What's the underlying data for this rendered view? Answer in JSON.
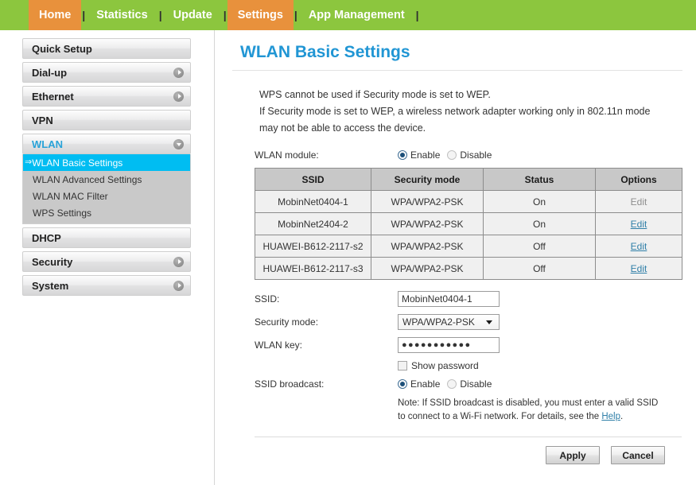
{
  "topnav": {
    "items": [
      {
        "label": "Home",
        "active": true
      },
      {
        "label": "Statistics",
        "active": false
      },
      {
        "label": "Update",
        "active": false
      },
      {
        "label": "Settings",
        "active": true
      },
      {
        "label": "App Management",
        "active": false
      }
    ],
    "separator": "|"
  },
  "sidebar": {
    "groups": [
      {
        "label": "Quick Setup",
        "icon": "none"
      },
      {
        "label": "Dial-up",
        "icon": "chevron-right-icon"
      },
      {
        "label": "Ethernet",
        "icon": "chevron-right-icon"
      },
      {
        "label": "VPN",
        "icon": "none"
      },
      {
        "label": "WLAN",
        "icon": "chevron-down-icon"
      },
      {
        "label": "DHCP",
        "icon": "none"
      },
      {
        "label": "Security",
        "icon": "chevron-right-icon"
      },
      {
        "label": "System",
        "icon": "chevron-right-icon"
      }
    ],
    "wlan_submenu": [
      {
        "label": "WLAN Basic Settings",
        "active": true
      },
      {
        "label": "WLAN Advanced Settings",
        "active": false
      },
      {
        "label": "WLAN MAC Filter",
        "active": false
      },
      {
        "label": "WPS Settings",
        "active": false
      }
    ],
    "active_marker": "⇒"
  },
  "main": {
    "title": "WLAN Basic Settings",
    "intro_lines": [
      "WPS cannot be used if Security mode is set to WEP.",
      "If Security mode is set to WEP, a wireless network adapter working only in 802.11n mode",
      "may not be able to access the device."
    ],
    "wlan_module": {
      "label": "WLAN module:",
      "enable_label": "Enable",
      "disable_label": "Disable",
      "selected": "Enable"
    },
    "table": {
      "headers": [
        "SSID",
        "Security mode",
        "Status",
        "Options"
      ],
      "rows": [
        {
          "ssid": "MobinNet0404-1",
          "security": "WPA/WPA2-PSK",
          "status": "On",
          "option": "Edit",
          "option_enabled": false
        },
        {
          "ssid": "MobinNet2404-2",
          "security": "WPA/WPA2-PSK",
          "status": "On",
          "option": "Edit",
          "option_enabled": true
        },
        {
          "ssid": "HUAWEI-B612-2117-s2",
          "security": "WPA/WPA2-PSK",
          "status": "Off",
          "option": "Edit",
          "option_enabled": true
        },
        {
          "ssid": "HUAWEI-B612-2117-s3",
          "security": "WPA/WPA2-PSK",
          "status": "Off",
          "option": "Edit",
          "option_enabled": true
        }
      ]
    },
    "form": {
      "ssid_label": "SSID:",
      "ssid_value": "MobinNet0404-1",
      "security_label": "Security mode:",
      "security_value": "WPA/WPA2-PSK",
      "wlan_key_label": "WLAN key:",
      "wlan_key_value": "●●●●●●●●●●●",
      "show_password_label": "Show password",
      "show_password_checked": false,
      "broadcast_label": "SSID broadcast:",
      "broadcast_enable_label": "Enable",
      "broadcast_disable_label": "Disable",
      "broadcast_selected": "Enable",
      "note_prefix": "Note: If SSID broadcast is disabled, you must enter a valid SSID to connect to a Wi-Fi network. For details, see the ",
      "note_link": "Help",
      "note_suffix": "."
    },
    "buttons": {
      "apply": "Apply",
      "cancel": "Cancel"
    }
  },
  "colors": {
    "nav_green": "#8cc63e",
    "nav_active_orange": "#e8913c",
    "title_blue": "#2196d4",
    "active_item_cyan": "#00bdf2",
    "link_blue": "#2f7fa8"
  }
}
